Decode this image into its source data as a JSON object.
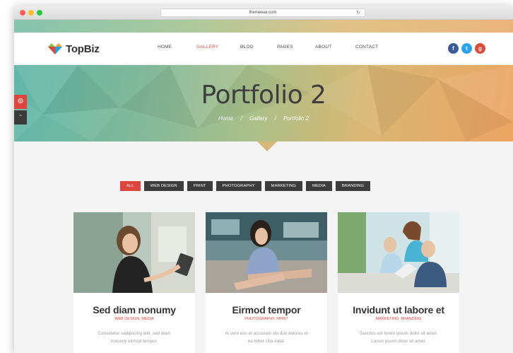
{
  "browser": {
    "url": "themewar.com"
  },
  "site": {
    "logo": "TopBiz",
    "nav": [
      "HOME",
      "GALLERY",
      "BLOG",
      "PAGES",
      "ABOUT",
      "CONTACT"
    ],
    "active_nav": "GALLERY",
    "social": {
      "facebook": "f",
      "twitter": "t",
      "googleplus": "g"
    }
  },
  "hero": {
    "title": "Portfolio 2",
    "breadcrumb": [
      "Home",
      "Gallery",
      "Portfolio 2"
    ],
    "separator": "/"
  },
  "filters": [
    "ALL",
    "WEB DESIGN",
    "PRINT",
    "PHOTOGRAPHY",
    "MARKETING",
    "MEDIA",
    "BRANDING"
  ],
  "active_filter": "ALL",
  "cards": [
    {
      "title": "Sed diam nonumy",
      "categories": "WEB DESIGN, MEDIA",
      "text_line1": "Consetetur sadipscing elitr, sed diam",
      "text_line2": "nonumy eirmod tempor."
    },
    {
      "title": "Eirmod tempor",
      "categories": "PHOTOGRAPHY, PRINT",
      "text_line1": "At vero eos et accusam sto duo dolores et",
      "text_line2": "ea rebet clita kasd."
    },
    {
      "title": "Invidunt ut labore et",
      "categories": "MARKETING, BRANDING",
      "text_line1": "Sanctus est lorem ipsum dolor sit amet.",
      "text_line2": "Lorem ipsum dolor sit amet."
    }
  ],
  "colors": {
    "accent": "#e0453d",
    "dark": "#3d3d3d",
    "facebook": "#3b5a9a",
    "twitter": "#2aa3ef",
    "googleplus": "#dd4b39"
  }
}
